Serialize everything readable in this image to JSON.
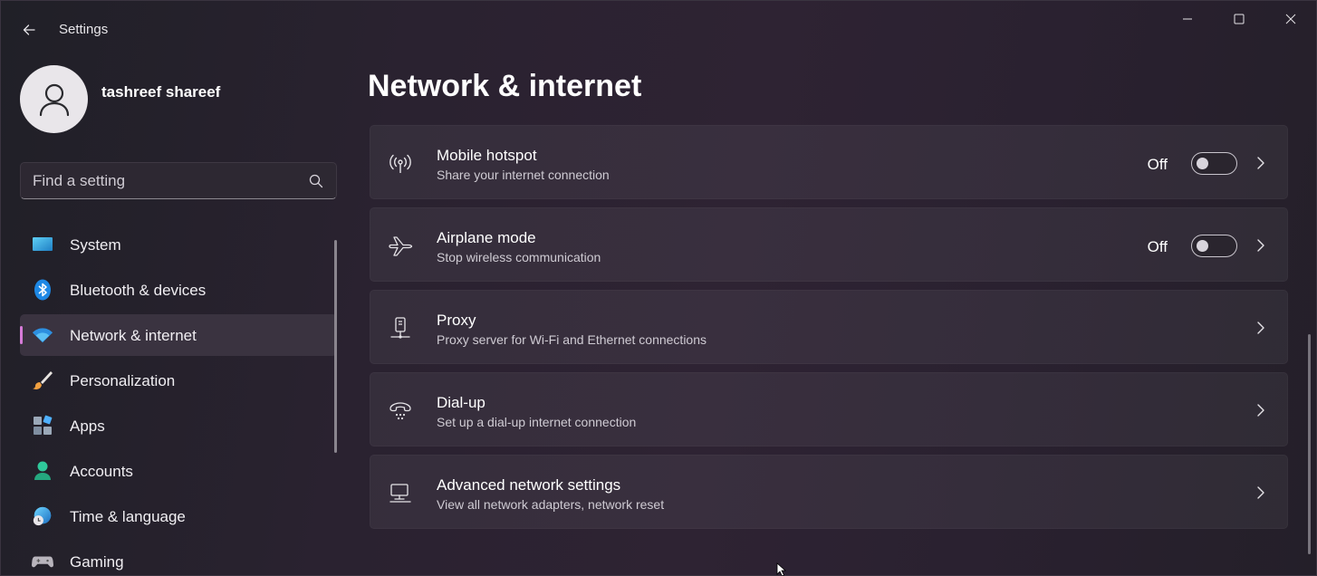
{
  "window": {
    "title": "Settings",
    "accent": "#d67bd8"
  },
  "profile": {
    "name": "tashreef shareef"
  },
  "search": {
    "placeholder": "Find a setting",
    "value": ""
  },
  "nav": {
    "items": [
      {
        "label": "System",
        "icon": "system-icon",
        "active": false
      },
      {
        "label": "Bluetooth & devices",
        "icon": "bluetooth-icon",
        "active": false
      },
      {
        "label": "Network & internet",
        "icon": "wifi-icon",
        "active": true
      },
      {
        "label": "Personalization",
        "icon": "brush-icon",
        "active": false
      },
      {
        "label": "Apps",
        "icon": "apps-icon",
        "active": false
      },
      {
        "label": "Accounts",
        "icon": "accounts-icon",
        "active": false
      },
      {
        "label": "Time & language",
        "icon": "globe-clock-icon",
        "active": false
      },
      {
        "label": "Gaming",
        "icon": "gamepad-icon",
        "active": false
      }
    ]
  },
  "main": {
    "title": "Network & internet",
    "cards": [
      {
        "title": "Mobile hotspot",
        "subtitle": "Share your internet connection",
        "icon": "hotspot-icon",
        "toggle": "Off"
      },
      {
        "title": "Airplane mode",
        "subtitle": "Stop wireless communication",
        "icon": "airplane-icon",
        "toggle": "Off"
      },
      {
        "title": "Proxy",
        "subtitle": "Proxy server for Wi-Fi and Ethernet connections",
        "icon": "proxy-icon"
      },
      {
        "title": "Dial-up",
        "subtitle": "Set up a dial-up internet connection",
        "icon": "dialup-icon"
      },
      {
        "title": "Advanced network settings",
        "subtitle": "View all network adapters, network reset",
        "icon": "network-pc-icon"
      }
    ]
  }
}
